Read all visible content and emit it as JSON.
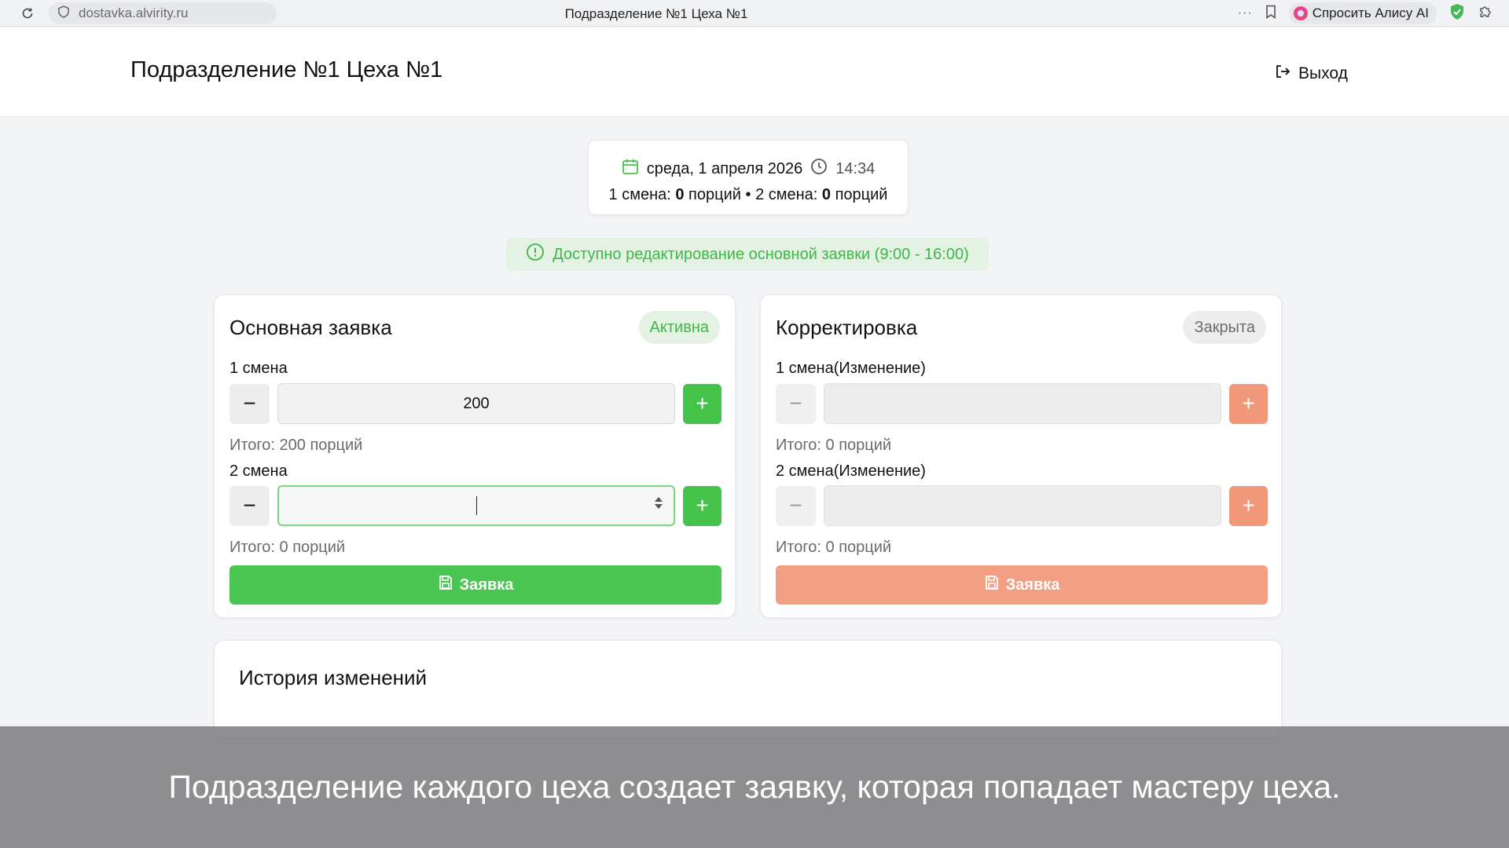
{
  "browser": {
    "url": "dostavka.alvirity.ru",
    "tab_title": "Подразделение №1 Цеха №1",
    "menu_dots": "···",
    "alisa_label": "Спросить Алису AI"
  },
  "header": {
    "title": "Подразделение №1 Цеха №1",
    "logout_label": "Выход"
  },
  "date_card": {
    "date": "среда, 1 апреля 2026",
    "time": "14:34",
    "shift1_label": "1 смена: ",
    "shift1_value": "0",
    "shift1_unit": " порций",
    "separator": " • ",
    "shift2_label": "2 смена: ",
    "shift2_value": "0",
    "shift2_unit": " порций"
  },
  "notice": {
    "text": "Доступно редактирование основной заявки (9:00 - 16:00)"
  },
  "main_order": {
    "title": "Основная заявка",
    "status": "Активна",
    "shift1_label": "1 смена",
    "shift1_value": "200",
    "shift1_total": "Итого: 200 порций",
    "shift2_label": "2 смена",
    "shift2_value": "",
    "shift2_total": "Итого: 0 порций",
    "submit_label": "Заявка"
  },
  "correction": {
    "title": "Корректировка",
    "status": "Закрыта",
    "shift1_label": "1 смена(Изменение)",
    "shift1_value": "",
    "shift1_total": "Итого: 0 порций",
    "shift2_label": "2 смена(Изменение)",
    "shift2_value": "",
    "shift2_total": "Итого: 0 порций",
    "submit_label": "Заявка"
  },
  "history": {
    "title": "История изменений"
  },
  "caption": {
    "text": "Подразделение каждого цеха создает заявку, которая попадает мастеру цеха."
  },
  "icons": {
    "minus": "−",
    "plus": "+"
  },
  "colors": {
    "green": "#44c24a",
    "orange": "#f2987a",
    "notice_green": "#3fb649"
  }
}
